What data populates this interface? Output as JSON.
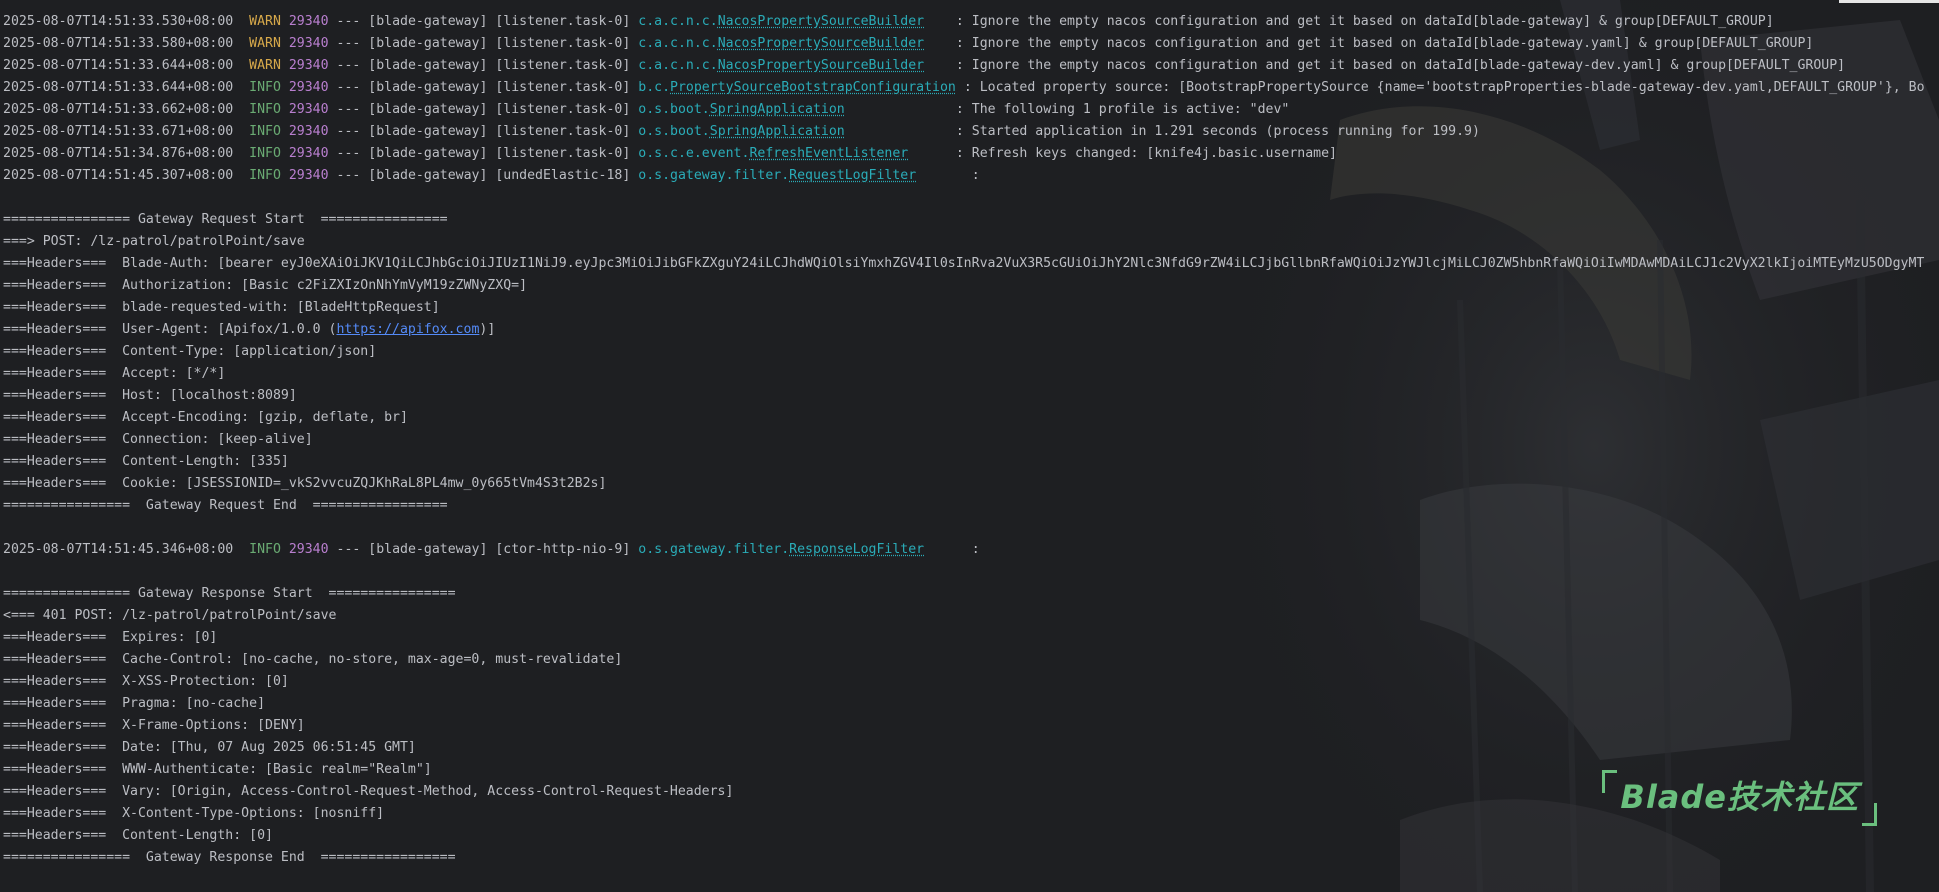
{
  "log_lines": [
    {
      "type": "log",
      "ts": "2025-08-07T14:51:33.530+08:00",
      "level": "WARN",
      "pad": " ",
      "pid": "29340",
      "sep": "---",
      "app": "[blade-gateway]",
      "thread": "[listener.task-0]",
      "pkg": "c.a.c.n.c.",
      "cls": "NacosPropertySourceBuilder",
      "gap": "    ",
      "msg": ": Ignore the empty nacos configuration and get it based on dataId[blade-gateway] & group[DEFAULT_GROUP]"
    },
    {
      "type": "log",
      "ts": "2025-08-07T14:51:33.580+08:00",
      "level": "WARN",
      "pad": " ",
      "pid": "29340",
      "sep": "---",
      "app": "[blade-gateway]",
      "thread": "[listener.task-0]",
      "pkg": "c.a.c.n.c.",
      "cls": "NacosPropertySourceBuilder",
      "gap": "    ",
      "msg": ": Ignore the empty nacos configuration and get it based on dataId[blade-gateway.yaml] & group[DEFAULT_GROUP]"
    },
    {
      "type": "log",
      "ts": "2025-08-07T14:51:33.644+08:00",
      "level": "WARN",
      "pad": " ",
      "pid": "29340",
      "sep": "---",
      "app": "[blade-gateway]",
      "thread": "[listener.task-0]",
      "pkg": "c.a.c.n.c.",
      "cls": "NacosPropertySourceBuilder",
      "gap": "    ",
      "msg": ": Ignore the empty nacos configuration and get it based on dataId[blade-gateway-dev.yaml] & group[DEFAULT_GROUP]"
    },
    {
      "type": "log",
      "ts": "2025-08-07T14:51:33.644+08:00",
      "level": "INFO",
      "pad": " ",
      "pid": "29340",
      "sep": "---",
      "app": "[blade-gateway]",
      "thread": "[listener.task-0]",
      "pkg": "b.c.",
      "cls": "PropertySourceBootstrapConfiguration",
      "gap": " ",
      "msg": ": Located property source: [BootstrapPropertySource {name='bootstrapProperties-blade-gateway-dev.yaml,DEFAULT_GROUP'}, Bo"
    },
    {
      "type": "log",
      "ts": "2025-08-07T14:51:33.662+08:00",
      "level": "INFO",
      "pad": " ",
      "pid": "29340",
      "sep": "---",
      "app": "[blade-gateway]",
      "thread": "[listener.task-0]",
      "pkg": "o.s.boot.",
      "cls": "SpringApplication",
      "gap": "              ",
      "msg": ": The following 1 profile is active: \"dev\""
    },
    {
      "type": "log",
      "ts": "2025-08-07T14:51:33.671+08:00",
      "level": "INFO",
      "pad": " ",
      "pid": "29340",
      "sep": "---",
      "app": "[blade-gateway]",
      "thread": "[listener.task-0]",
      "pkg": "o.s.boot.",
      "cls": "SpringApplication",
      "gap": "              ",
      "msg": ": Started application in 1.291 seconds (process running for 199.9)"
    },
    {
      "type": "log",
      "ts": "2025-08-07T14:51:34.876+08:00",
      "level": "INFO",
      "pad": " ",
      "pid": "29340",
      "sep": "---",
      "app": "[blade-gateway]",
      "thread": "[listener.task-0]",
      "pkg": "o.s.c.e.event.",
      "cls": "RefreshEventListener",
      "gap": "      ",
      "msg": ": Refresh keys changed: [knife4j.basic.username]"
    },
    {
      "type": "log",
      "ts": "2025-08-07T14:51:45.307+08:00",
      "level": "INFO",
      "pad": " ",
      "pid": "29340",
      "sep": "---",
      "app": "[blade-gateway]",
      "thread": "[undedElastic-18]",
      "pkg": "o.s.gateway.filter.",
      "cls": "RequestLogFilter",
      "gap": "       ",
      "msg": ":"
    },
    {
      "type": "blank"
    },
    {
      "type": "text",
      "text": "================ Gateway Request Start  ================"
    },
    {
      "type": "text",
      "text": "===> POST: /lz-patrol/patrolPoint/save"
    },
    {
      "type": "text",
      "text": "===Headers===  Blade-Auth: [bearer eyJ0eXAiOiJKV1QiLCJhbGciOiJIUzI1NiJ9.eyJpc3MiOiJibGFkZXguY24iLCJhdWQiOlsiYmxhZGV4Il0sInRva2VuX3R5cGUiOiJhY2Nlc3NfdG9rZW4iLCJjbGllbnRfaWQiOiJzYWJlcjMiLCJ0ZW5hbnRfaWQiOiIwMDAwMDAiLCJ1c2VyX2lkIjoiMTEyMzU5ODgyMT"
    },
    {
      "type": "text",
      "text": "===Headers===  Authorization: [Basic c2FiZXIzOnNhYmVyM19zZWNyZXQ=]"
    },
    {
      "type": "text",
      "text": "===Headers===  blade-requested-with: [BladeHttpRequest]"
    },
    {
      "type": "link",
      "before": "===Headers===  User-Agent: [Apifox/1.0.0 (",
      "link": "https://apifox.com",
      "after": ")]"
    },
    {
      "type": "text",
      "text": "===Headers===  Content-Type: [application/json]"
    },
    {
      "type": "text",
      "text": "===Headers===  Accept: [*/*]"
    },
    {
      "type": "text",
      "text": "===Headers===  Host: [localhost:8089]"
    },
    {
      "type": "text",
      "text": "===Headers===  Accept-Encoding: [gzip, deflate, br]"
    },
    {
      "type": "text",
      "text": "===Headers===  Connection: [keep-alive]"
    },
    {
      "type": "text",
      "text": "===Headers===  Content-Length: [335]"
    },
    {
      "type": "text",
      "text": "===Headers===  Cookie: [JSESSIONID=_vkS2vvcuZQJKhRaL8PL4mw_0y665tVm4S3t2B2s]"
    },
    {
      "type": "text",
      "text": "================  Gateway Request End  ================="
    },
    {
      "type": "blank"
    },
    {
      "type": "log",
      "ts": "2025-08-07T14:51:45.346+08:00",
      "level": "INFO",
      "pad": " ",
      "pid": "29340",
      "sep": "---",
      "app": "[blade-gateway]",
      "thread": "[ctor-http-nio-9]",
      "pkg": "o.s.gateway.filter.",
      "cls": "ResponseLogFilter",
      "gap": "      ",
      "msg": ":"
    },
    {
      "type": "blank"
    },
    {
      "type": "text",
      "text": "================ Gateway Response Start  ================"
    },
    {
      "type": "text",
      "text": "<=== 401 POST: /lz-patrol/patrolPoint/save"
    },
    {
      "type": "text",
      "text": "===Headers===  Expires: [0]"
    },
    {
      "type": "text",
      "text": "===Headers===  Cache-Control: [no-cache, no-store, max-age=0, must-revalidate]"
    },
    {
      "type": "text",
      "text": "===Headers===  X-XSS-Protection: [0]"
    },
    {
      "type": "text",
      "text": "===Headers===  Pragma: [no-cache]"
    },
    {
      "type": "text",
      "text": "===Headers===  X-Frame-Options: [DENY]"
    },
    {
      "type": "text",
      "text": "===Headers===  Date: [Thu, 07 Aug 2025 06:51:45 GMT]"
    },
    {
      "type": "text",
      "text": "===Headers===  WWW-Authenticate: [Basic realm=\"Realm\"]"
    },
    {
      "type": "text",
      "text": "===Headers===  Vary: [Origin, Access-Control-Request-Method, Access-Control-Request-Headers]"
    },
    {
      "type": "text",
      "text": "===Headers===  X-Content-Type-Options: [nosniff]"
    },
    {
      "type": "text",
      "text": "===Headers===  Content-Length: [0]"
    },
    {
      "type": "text",
      "text": "================  Gateway Response End  ================="
    }
  ],
  "watermark": {
    "text": "Blade技术社区"
  },
  "colors": {
    "background": "#1e1f22",
    "text": "#bcbec4",
    "warn": "#d6a84a",
    "info": "#6aab73",
    "pid": "#b97fcf",
    "logger": "#2aacb8",
    "link": "#548af7",
    "watermark": "#6abf7e"
  }
}
